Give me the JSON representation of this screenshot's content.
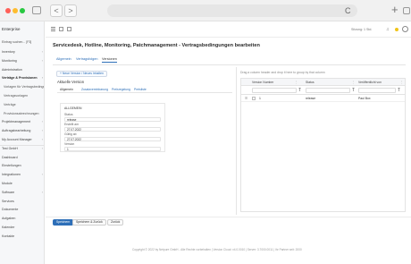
{
  "browser": {
    "nav_back": "<",
    "nav_forward": ">",
    "reload_icon": "C",
    "new_tab_icon": "+"
  },
  "sidebar": {
    "brand": "Enterprise",
    "search": "Eintrag suchen... [F3]",
    "items": [
      {
        "label": "Inventory",
        "has_arrow": true
      },
      {
        "label": "Monitoring",
        "has_arrow": true
      },
      {
        "label": "Administration",
        "has_arrow": false
      },
      {
        "label": "Verträge & Provisionen",
        "has_arrow": true,
        "active": true
      },
      {
        "label": "Vorlagen für Vertragsbedingungen",
        "sub": true
      },
      {
        "label": "Vertragsvorlagen",
        "sub": true
      },
      {
        "label": "Verträge",
        "sub": true
      },
      {
        "label": "Provisionsabrechnungen",
        "sub": true
      },
      {
        "label": "Projektmanagement",
        "has_arrow": true
      },
      {
        "label": "Auftragsbearbeitung",
        "has_arrow": true
      },
      {
        "label": "My Account Manager",
        "has_arrow": true
      },
      {
        "label": "Test GmbH",
        "has_arrow": true
      },
      {
        "label": "Dashboard",
        "has_arrow": false
      },
      {
        "label": "Einstellungen",
        "has_arrow": false
      },
      {
        "label": "Integrationen",
        "has_arrow": true
      },
      {
        "label": "Module",
        "has_arrow": false
      },
      {
        "label": "Software",
        "has_arrow": true
      },
      {
        "label": "Services",
        "has_arrow": false
      },
      {
        "label": "Dokumente",
        "has_arrow": false
      },
      {
        "label": "Aufgaben",
        "has_arrow": false
      },
      {
        "label": "Kalender",
        "has_arrow": false
      },
      {
        "label": "Kontakte",
        "has_arrow": false
      }
    ]
  },
  "topbar": {
    "session": "Sitzung: 1 Std.",
    "bell_icon": "bell-icon",
    "user_icon": "user-icon"
  },
  "main": {
    "title": "Servicedesk, Hotline, Monitoring, Patchmanagement - Vertragsbedingungen bearbeiten",
    "tabs": [
      "Allgemein",
      "Vertragsfolgen",
      "Versionen"
    ],
    "new_version_button": "+ Neue Version / Neues Inhalten",
    "section_title": "Aktuelle Version",
    "subtabs": [
      "Allgemein",
      "Zusatzvereinbarung",
      "Preisregelung",
      "Preisliste"
    ],
    "form": {
      "heading": "ALLGEMEIN",
      "status_label": "Status",
      "status_value": "release",
      "created_label": "Erstellt am",
      "created_value": "27.07.2022",
      "valid_label": "Gültig ab",
      "valid_value": "27.07.2022",
      "version_label": "Version",
      "version_value": "1"
    }
  },
  "grid": {
    "group_hint": "Drag a column header and drop it here to group by that column",
    "columns": [
      "Version Number",
      "Status",
      "Veröffentlicht von"
    ],
    "filter_icon": "T",
    "rows": [
      {
        "version": "1",
        "status": "release",
        "published_by": "Paul Box"
      }
    ]
  },
  "actions": {
    "save": "Speichern",
    "save_back": "Speichern & Zurück",
    "back": "Zurück"
  },
  "footer": "Copyright © 2022 by Netpure GmbH - Alle Rechte vorbehalten | Version Cloud: v4.0.0010 | Server: 3.7000.0011 | Ihr Partner seit: 2000"
}
